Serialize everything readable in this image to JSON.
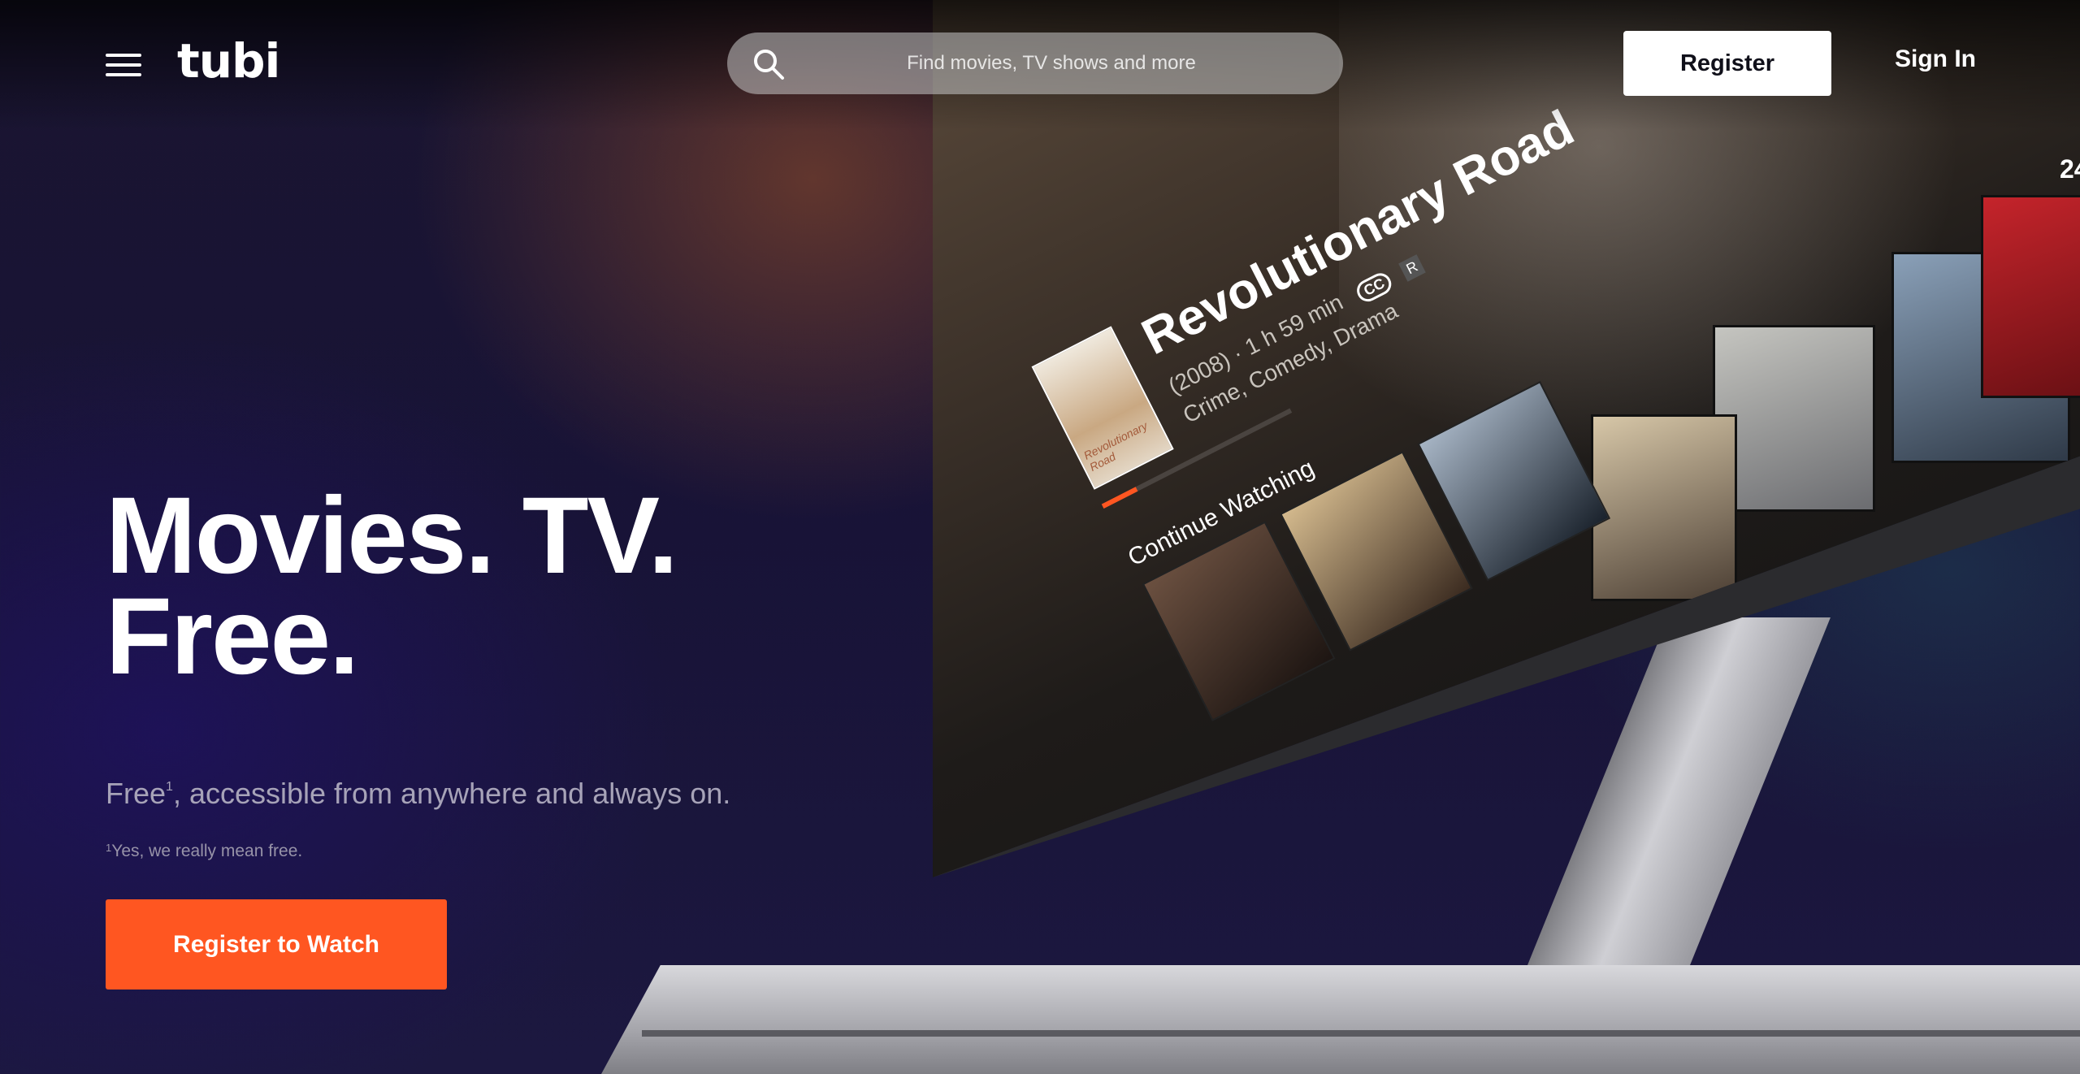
{
  "header": {
    "logo_text": "tubi",
    "search_placeholder": "Find movies, TV shows and more",
    "register_label": "Register",
    "signin_label": "Sign In"
  },
  "hero": {
    "title_line1": "Movies. TV.",
    "title_line2": "Free.",
    "subtitle_pre": "Free",
    "subtitle_sup": "1",
    "subtitle_post": ", accessible from anywhere and always on.",
    "footnote_sup": "1",
    "footnote_text": "Yes, we really mean free.",
    "cta_label": "Register to Watch"
  },
  "tv": {
    "movie_title": "Revolutionary Road",
    "movie_meta": "(2008) · 1 h 59 min",
    "movie_genres": "Crime, Comedy, Drama",
    "cc_badge": "CC",
    "rating_badge": "R",
    "poster_label": "Revolutionary Road",
    "section_label": "Continue Watching",
    "corner_text": "24",
    "progress": 0.18
  },
  "colors": {
    "accent": "#ff5621",
    "background": "#181337",
    "text_primary": "#ffffff",
    "text_muted": "#a7a3b8"
  }
}
